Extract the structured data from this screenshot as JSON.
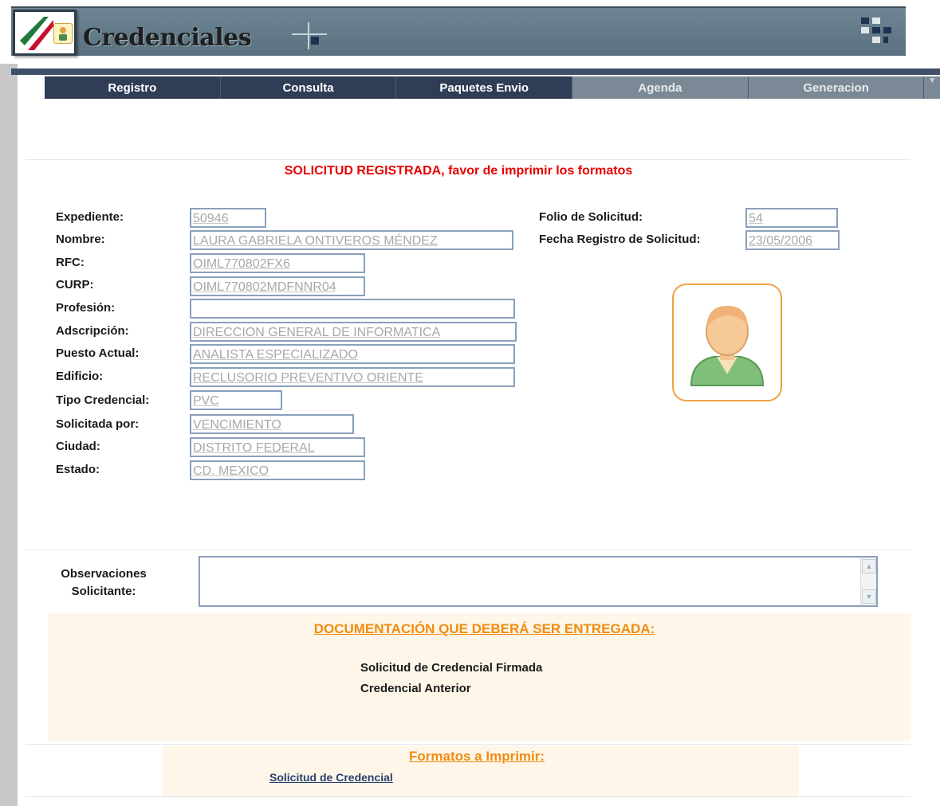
{
  "header": {
    "title": "Credenciales"
  },
  "tabs": [
    {
      "label": "Registro",
      "active": true
    },
    {
      "label": "Consulta",
      "active": true
    },
    {
      "label": "Paquetes Envio",
      "active": true
    },
    {
      "label": "Agenda",
      "active": false
    },
    {
      "label": "Generacion",
      "active": false
    }
  ],
  "message": "SOLICITUD REGISTRADA, favor de imprimir los formatos",
  "form": {
    "expediente": {
      "label": "Expediente:",
      "value": "50946"
    },
    "nombre": {
      "label": "Nombre:",
      "value": "LAURA GABRIELA ONTIVEROS MÉNDEZ"
    },
    "rfc": {
      "label": "RFC:",
      "value": "OIML770802FX6"
    },
    "curp": {
      "label": "CURP:",
      "value": "OIML770802MDFNNR04"
    },
    "profesion": {
      "label": "Profesión:",
      "value": ""
    },
    "adscripcion": {
      "label": "Adscripción:",
      "value": "DIRECCION GENERAL DE INFORMATICA"
    },
    "puesto": {
      "label": "Puesto Actual:",
      "value": "ANALISTA ESPECIALIZADO"
    },
    "edificio": {
      "label": "Edificio:",
      "value": "RECLUSORIO PREVENTIVO ORIENTE"
    },
    "tipo": {
      "label": "Tipo Credencial:",
      "value": "PVC"
    },
    "solicitada": {
      "label": "Solicitada por:",
      "value": "VENCIMIENTO"
    },
    "ciudad": {
      "label": "Ciudad:",
      "value": "DISTRITO FEDERAL"
    },
    "estado": {
      "label": "Estado:",
      "value": "CD. MEXICO"
    },
    "folio": {
      "label": "Folio de Solicitud:",
      "value": "54"
    },
    "fecha": {
      "label": "Fecha Registro de Solicitud:",
      "value": "23/05/2006"
    }
  },
  "observaciones": {
    "label_line1": "Observaciones",
    "label_line2": "Solicitante:",
    "value": ""
  },
  "documentacion": {
    "title": "DOCUMENTACIÓN QUE DEBERÁ SER ENTREGADA:",
    "items": [
      "Solicitud de Credencial Firmada",
      "Credencial Anterior"
    ]
  },
  "formatos": {
    "title": "Formatos a Imprimir:",
    "link": "Solicitud de Credencial"
  },
  "colors": {
    "tab_bg": "#2f3d57",
    "tab_inactive": "#7b8895",
    "message": "#e60000",
    "accent": "#f08c10",
    "field_border": "#8aa0bc"
  },
  "icons": {
    "logo": "mexico-flag-logo-icon",
    "photo": "user-avatar-icon",
    "header_left": "crosshair-decor-icon",
    "header_right": "grid-decor-icon"
  }
}
